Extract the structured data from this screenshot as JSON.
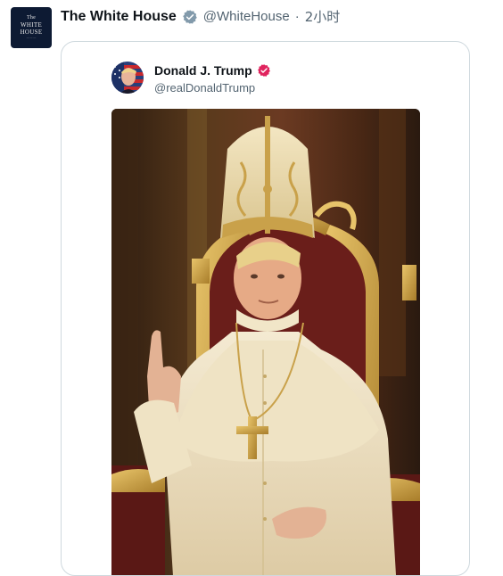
{
  "post": {
    "author_name": "The White House",
    "author_handle": "@WhiteHouse",
    "separator": "·",
    "time": "2小时",
    "avatar_text": {
      "line1": "The",
      "line2": "WHITE",
      "line3": "HOUSE"
    },
    "verified_icon": "verified-badge-icon",
    "colors": {
      "verified_gray": "#829aab",
      "handle": "#536471",
      "border": "#cfd9de"
    }
  },
  "quoted_post": {
    "author_name": "Donald J. Trump",
    "author_handle": "@realDonaldTrump",
    "verified_icon": "verified-badge-icon",
    "colors": {
      "verified_pink": "#e0245e"
    },
    "media": {
      "kind": "image",
      "icon": "pope-portrait-image"
    }
  }
}
